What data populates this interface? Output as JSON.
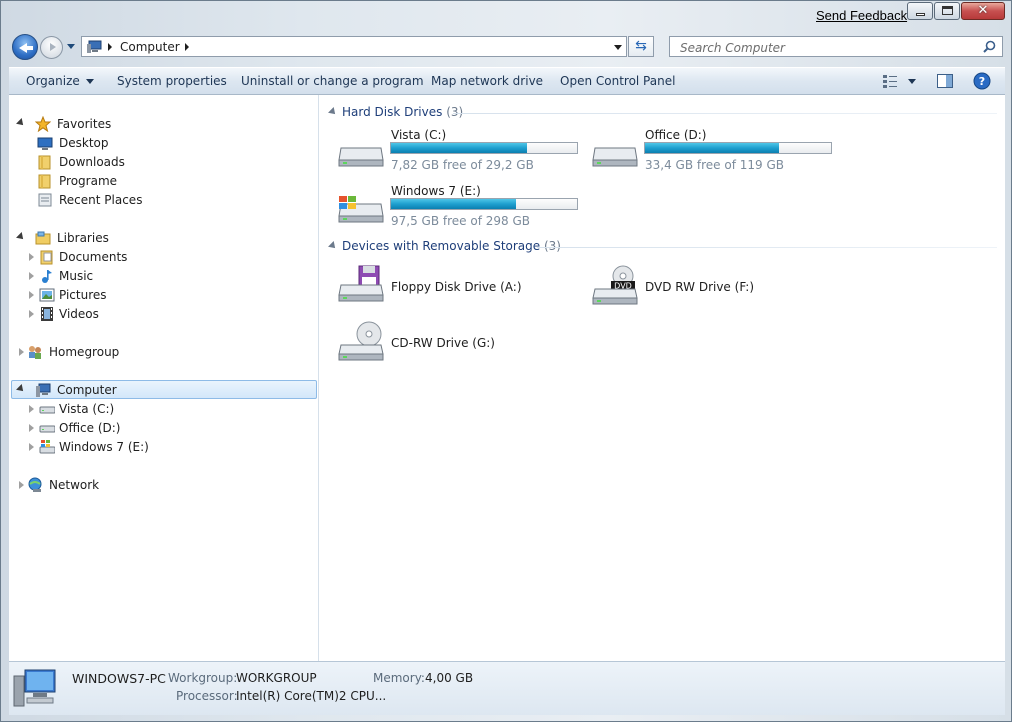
{
  "window": {
    "send_feedback": "Send Feedback",
    "caption": {
      "minimize": "minimize",
      "maximize": "maximize",
      "close": "close"
    }
  },
  "address": {
    "location": "Computer"
  },
  "search": {
    "placeholder": "Search Computer"
  },
  "toolbar": {
    "organize": "Organize",
    "system_properties": "System properties",
    "uninstall": "Uninstall or change a program",
    "map_drive": "Map network drive",
    "control_panel": "Open Control Panel"
  },
  "nav": {
    "favorites": {
      "label": "Favorites",
      "items": [
        "Desktop",
        "Downloads",
        "Programe",
        "Recent Places"
      ]
    },
    "libraries": {
      "label": "Libraries",
      "items": [
        "Documents",
        "Music",
        "Pictures",
        "Videos"
      ]
    },
    "homegroup": "Homegroup",
    "computer": {
      "label": "Computer",
      "items": [
        "Vista (C:)",
        "Office (D:)",
        "Windows 7 (E:)"
      ]
    },
    "network": "Network"
  },
  "content": {
    "hdd_group": {
      "title": "Hard Disk Drives",
      "count": "(3)"
    },
    "drives": [
      {
        "name": "Vista (C:)",
        "free": "7,82 GB free of 29,2 GB",
        "used_fraction": 0.732
      },
      {
        "name": "Office (D:)",
        "free": "33,4 GB free of 119 GB",
        "used_fraction": 0.719
      },
      {
        "name": "Windows 7 (E:)",
        "free": "97,5 GB free of 298 GB",
        "used_fraction": 0.673
      }
    ],
    "removable_group": {
      "title": "Devices with Removable Storage",
      "count": "(3)"
    },
    "removable": [
      "Floppy Disk Drive (A:)",
      "DVD RW Drive (F:)",
      "CD-RW Drive (G:)"
    ]
  },
  "details": {
    "pc_name": "WINDOWS7-PC",
    "workgroup_label": "Workgroup:",
    "workgroup": "WORKGROUP",
    "memory_label": "Memory:",
    "memory": "4,00 GB",
    "processor_label": "Processor:",
    "processor": "Intel(R) Core(TM)2 CPU..."
  },
  "colors": {
    "accent": "#1f9fcf",
    "selection": "#d3e7fa",
    "group_header": "#1e3e79"
  }
}
